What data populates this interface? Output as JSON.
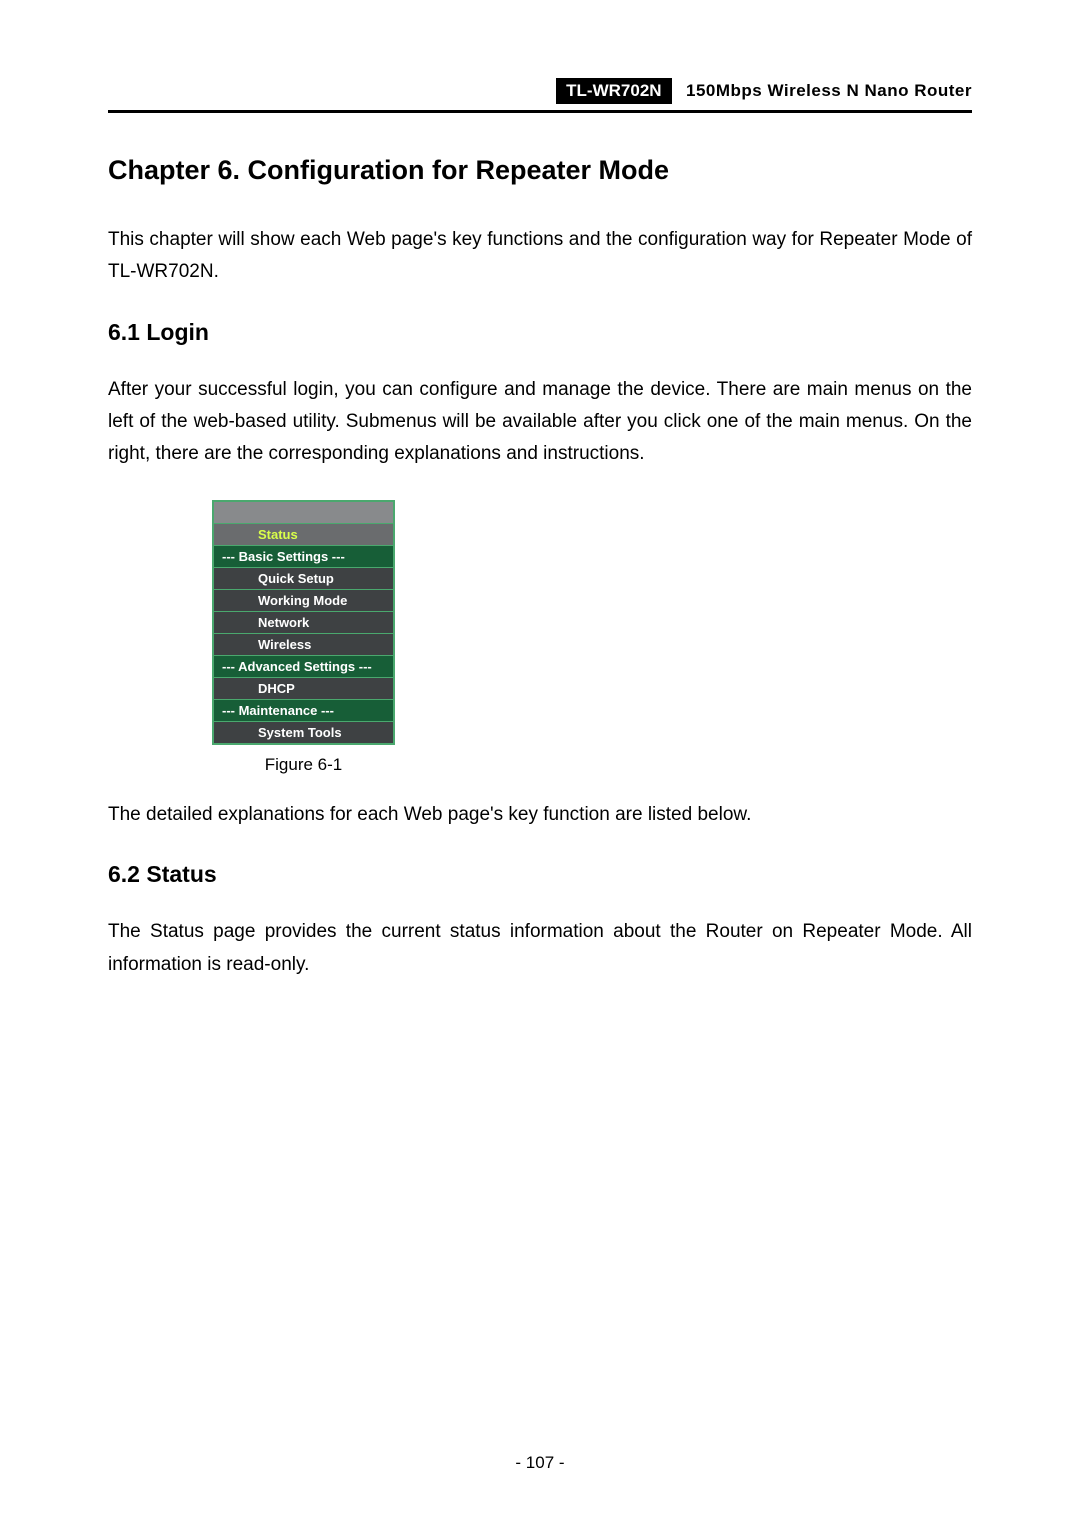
{
  "header": {
    "model": "TL-WR702N",
    "desc": "150Mbps  Wireless  N  Nano  Router"
  },
  "chapter": {
    "title": "Chapter 6.   Configuration for Repeater Mode",
    "intro": "This chapter will show each Web page's key functions and the configuration way for Repeater Mode of TL-WR702N."
  },
  "section_login": {
    "title": "6.1  Login",
    "text": "After your successful login, you can configure and manage the device. There are main menus on the left of the web-based utility. Submenus will be available after you click one of the main menus. On the right, there are the corresponding explanations and instructions.",
    "after_figure": "The detailed explanations for each Web page's key function are listed below."
  },
  "menu": {
    "active": "Status",
    "section_basic": "--- Basic Settings ---",
    "items_basic": {
      "quick_setup": "Quick Setup",
      "working_mode": "Working Mode",
      "network": "Network",
      "wireless": "Wireless"
    },
    "section_advanced": "--- Advanced Settings ---",
    "items_advanced": {
      "dhcp": "DHCP"
    },
    "section_maintenance": "--- Maintenance ---",
    "items_maintenance": {
      "system_tools": "System Tools"
    }
  },
  "figure_caption": "Figure 6-1",
  "section_status": {
    "title": "6.2  Status",
    "text": "The Status page provides the current status information about the Router on Repeater Mode. All information is read-only."
  },
  "page_number": "- 107 -"
}
